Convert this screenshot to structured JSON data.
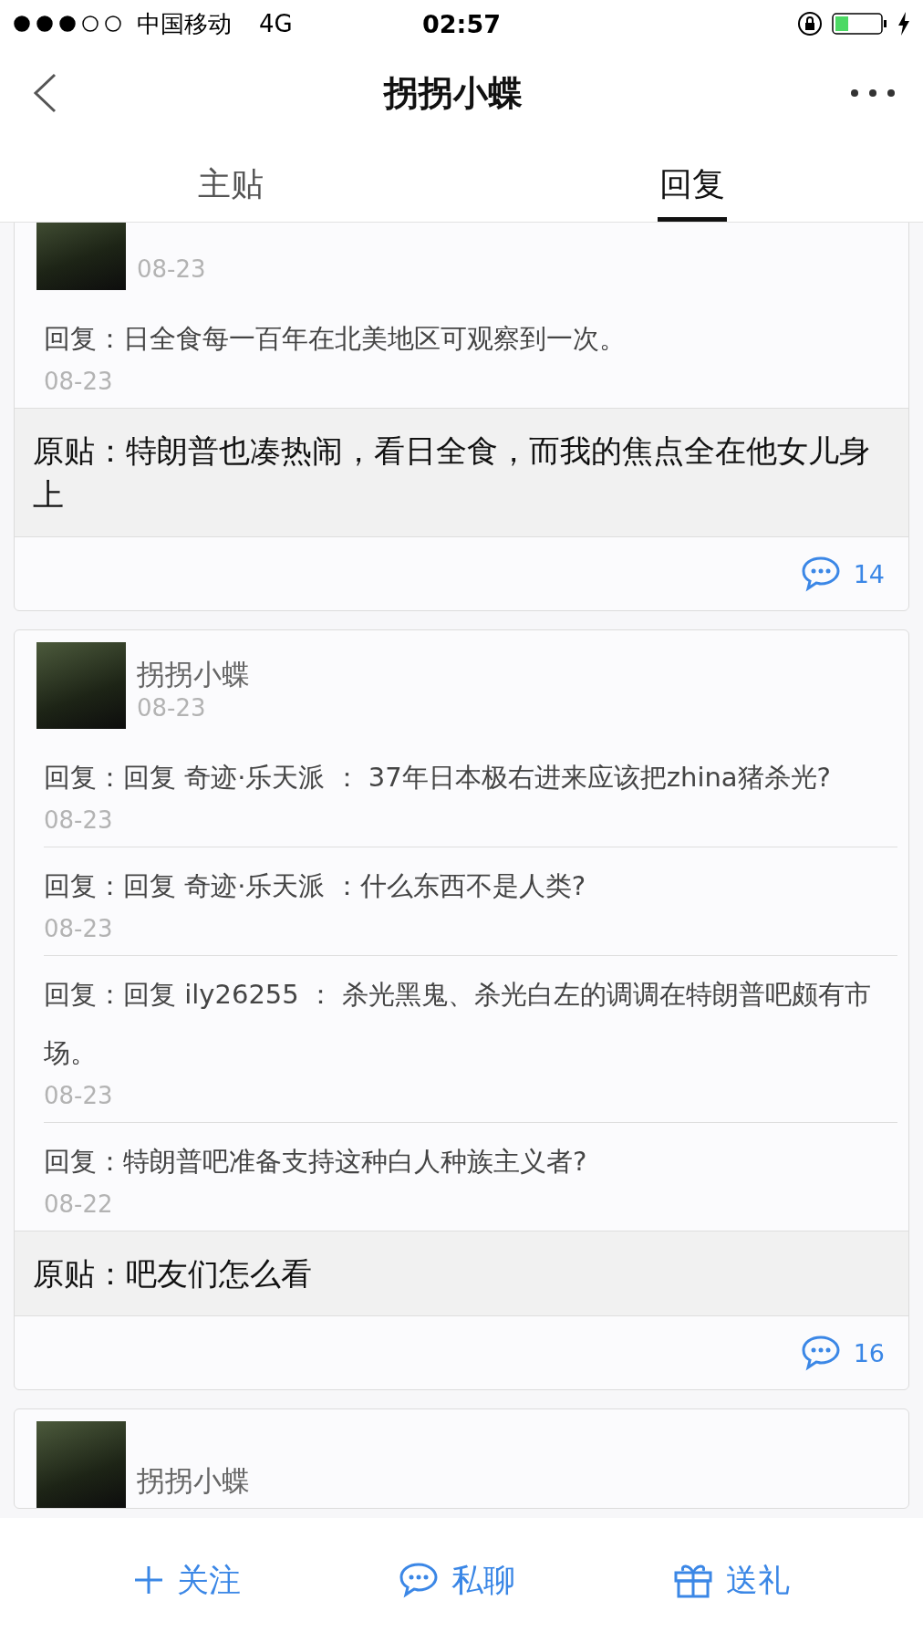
{
  "status_bar": {
    "carrier": "中国移动",
    "network": "4G",
    "time": "02:57"
  },
  "nav": {
    "title": "拐拐小蝶"
  },
  "tabs": [
    {
      "label": "主贴",
      "selected": false
    },
    {
      "label": "回复",
      "selected": true
    }
  ],
  "cards": [
    {
      "date": "08-23",
      "replies": [
        {
          "text": "回复：日全食每一百年在北美地区可观察到一次。",
          "date": "08-23"
        }
      ],
      "original": "原贴：特朗普也凑热闹，看日全食，而我的焦点全在他女儿身上",
      "comment_count": "14"
    },
    {
      "author": "拐拐小蝶",
      "date": "08-23",
      "replies": [
        {
          "text": "回复：回复 奇迹·乐天派 ： 37年日本极右进来应该把zhina猪杀光?",
          "date": "08-23"
        },
        {
          "text": "回复：回复 奇迹·乐天派 ：什么东西不是人类?",
          "date": "08-23"
        },
        {
          "text": "回复：回复 ily26255 ： 杀光黑鬼、杀光白左的调调在特朗普吧颇有市场。",
          "date": "08-23"
        },
        {
          "text": "回复：特朗普吧准备支持这种白人种族主义者?",
          "date": "08-22"
        }
      ],
      "original": "原贴：吧友们怎么看",
      "comment_count": "16"
    },
    {
      "author": "拐拐小蝶"
    }
  ],
  "actions": [
    {
      "kind": "follow",
      "label": "关注"
    },
    {
      "kind": "chat",
      "label": "私聊"
    },
    {
      "kind": "gift",
      "label": "送礼"
    }
  ]
}
